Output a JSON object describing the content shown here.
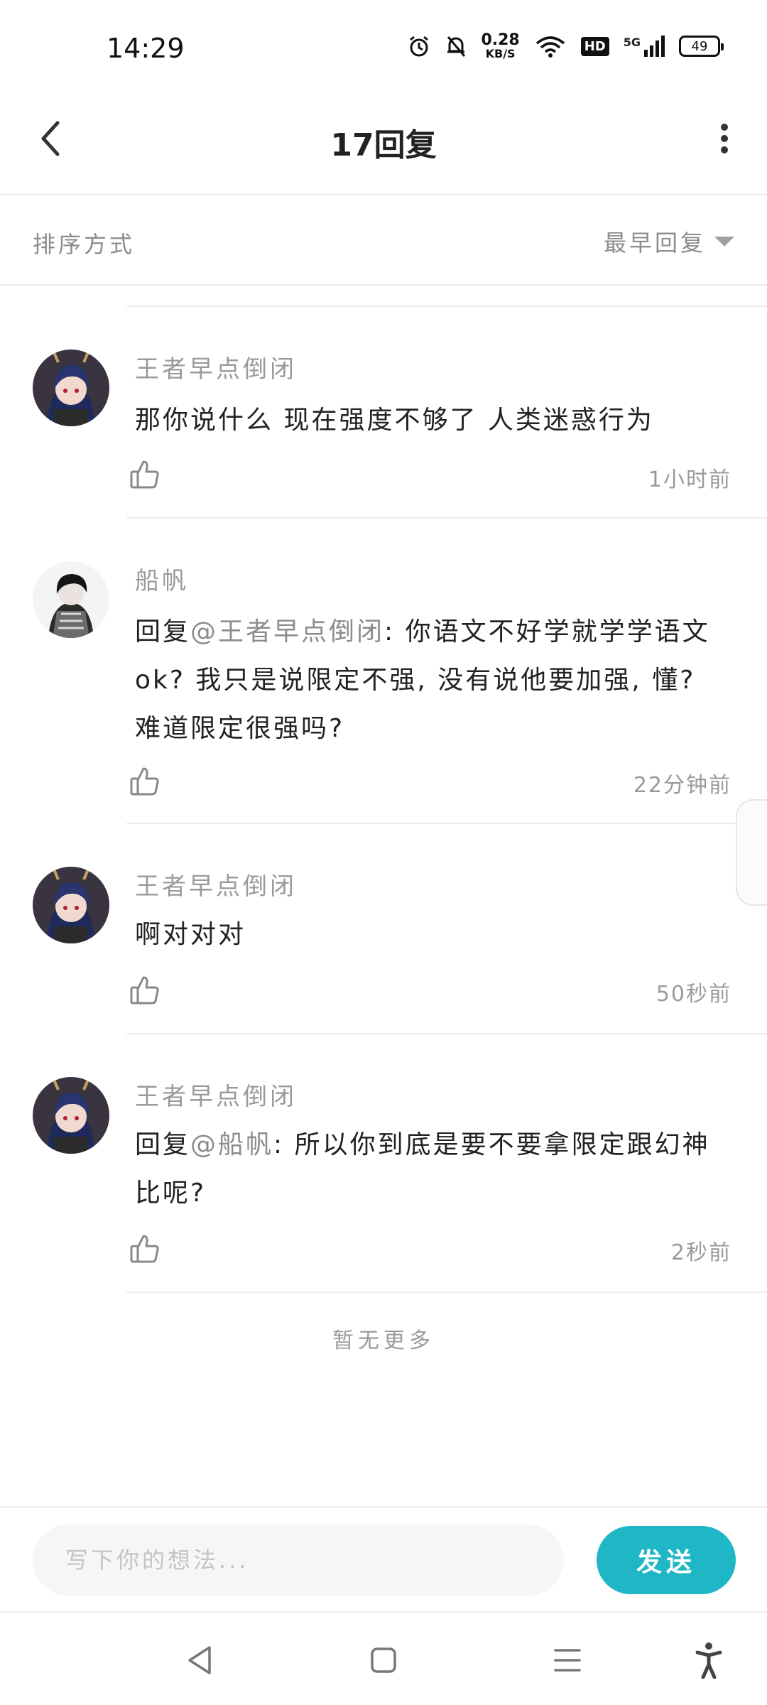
{
  "status_bar": {
    "time": "14:29",
    "net_speed_value": "0.28",
    "net_speed_unit": "KB/S",
    "hd_label": "HD",
    "network_label": "5G",
    "battery": "49"
  },
  "header": {
    "title": "17回复"
  },
  "sort": {
    "label": "排序方式",
    "selected": "最早回复"
  },
  "comments": [
    {
      "user": "王者早点倒闭",
      "avatar": "anime-avatar",
      "text": "那你说什么 现在强度不够了  人类迷惑行为",
      "mention": "",
      "time": "1小时前"
    },
    {
      "user": "船帆",
      "avatar": "dark-hair-avatar",
      "text_prefix": "回复",
      "mention": "@王者早点倒闭",
      "text": ": 你语文不好学就学学语文ok? 我只是说限定不强, 没有说他要加强, 懂? 难道限定很强吗?",
      "time": "22分钟前"
    },
    {
      "user": "王者早点倒闭",
      "avatar": "anime-avatar",
      "text": "啊对对对",
      "mention": "",
      "time": "50秒前"
    },
    {
      "user": "王者早点倒闭",
      "avatar": "anime-avatar",
      "text_prefix": "回复",
      "mention": "@船帆",
      "text": ": 所以你到底是要不要拿限定跟幻神比呢?",
      "time": "2秒前"
    }
  ],
  "footer": {
    "no_more": "暂无更多"
  },
  "input": {
    "placeholder": "写下你的想法...",
    "send_label": "发送"
  },
  "colors": {
    "accent": "#1fb6c6",
    "muted_text": "#9a9a9a",
    "divider": "#ececec"
  }
}
